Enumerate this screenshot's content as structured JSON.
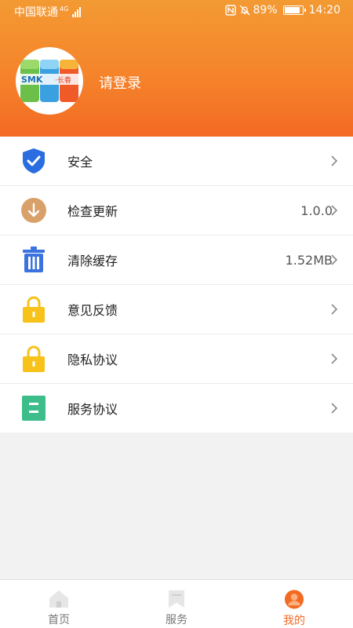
{
  "status_bar": {
    "carrier": "中国联通",
    "network": "4G",
    "battery": "89%",
    "time": "14:20"
  },
  "profile": {
    "login_text": "请登录",
    "avatar_logo": "SMK·长春"
  },
  "menu": {
    "items": [
      {
        "label": "安全",
        "value": "",
        "icon": "shield-check-icon"
      },
      {
        "label": "检查更新",
        "value": "1.0.0",
        "icon": "download-arrow-icon"
      },
      {
        "label": "清除缓存",
        "value": "1.52MB",
        "icon": "trash-icon"
      },
      {
        "label": "意见反馈",
        "value": "",
        "icon": "lock-icon"
      },
      {
        "label": "隐私协议",
        "value": "",
        "icon": "lock-icon"
      },
      {
        "label": "服务协议",
        "value": "",
        "icon": "document-icon"
      }
    ]
  },
  "tabbar": {
    "tabs": [
      {
        "label": "首页",
        "icon": "home-icon"
      },
      {
        "label": "服务",
        "icon": "service-icon"
      },
      {
        "label": "我的",
        "icon": "user-icon"
      }
    ],
    "active": "我的"
  },
  "colors": {
    "accent": "#f36a23",
    "header_top": "#f39a33",
    "shield": "#2a6de0",
    "update": "#d9a06a",
    "trash": "#3a72e0",
    "lock": "#f7c21a",
    "document": "#3dbd8a"
  }
}
